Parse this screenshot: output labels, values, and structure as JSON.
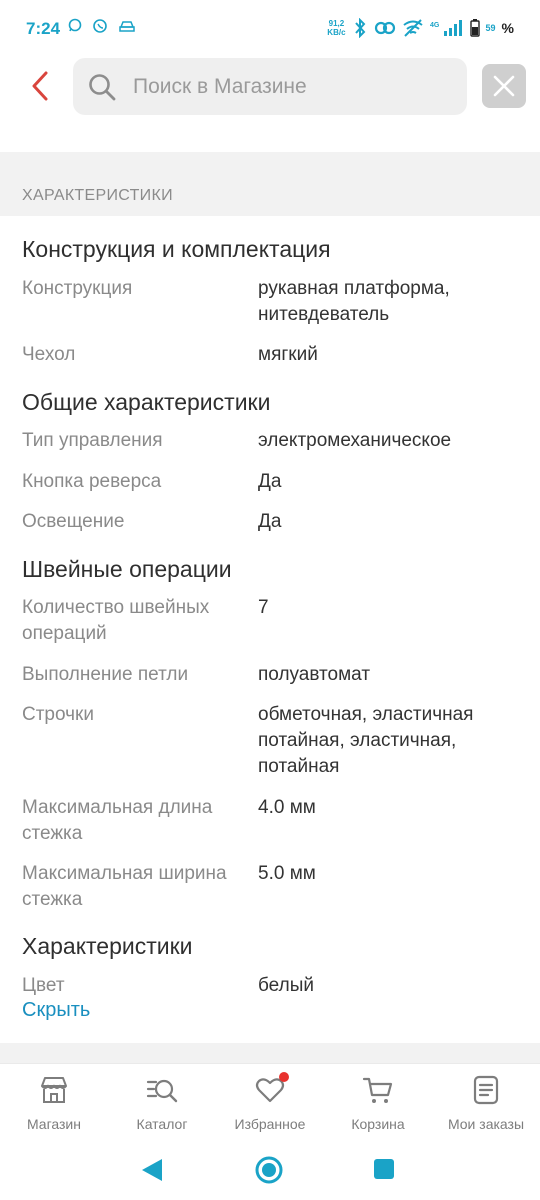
{
  "status_bar": {
    "time": "7:24",
    "net_speed_value": "91,2",
    "net_speed_unit": "KB/c",
    "battery": "59",
    "percent": "%"
  },
  "search": {
    "placeholder": "Поиск в Магазине"
  },
  "section": {
    "title": "ХАРАКТЕРИСТИКИ"
  },
  "groups": [
    {
      "title": "Конструкция и комплектация",
      "rows": [
        {
          "label": "Конструкция",
          "value": "рукавная платформа, нитевдеватель"
        },
        {
          "label": "Чехол",
          "value": "мягкий"
        }
      ]
    },
    {
      "title": "Общие характеристики",
      "rows": [
        {
          "label": "Тип управления",
          "value": "электромеханическое"
        },
        {
          "label": "Кнопка реверса",
          "value": "Да"
        },
        {
          "label": "Освещение",
          "value": "Да"
        }
      ]
    },
    {
      "title": "Швейные операции",
      "rows": [
        {
          "label": "Количество швейных операций",
          "value": "7"
        },
        {
          "label": "Выполнение петли",
          "value": "полуавтомат"
        },
        {
          "label": "Строчки",
          "value": "обметочная, эластичная потайная, эластичная, потайная"
        },
        {
          "label": "Максимальная длина стежка",
          "value": "4.0 мм"
        },
        {
          "label": "Максимальная ширина стежка",
          "value": "5.0 мм"
        }
      ]
    },
    {
      "title": "Характеристики",
      "rows": [
        {
          "label": "Цвет",
          "value": "белый"
        }
      ]
    }
  ],
  "hide_link": "Скрыть",
  "bottom_nav": [
    {
      "label": "Магазин",
      "icon": "store-icon"
    },
    {
      "label": "Каталог",
      "icon": "catalog-search-icon"
    },
    {
      "label": "Избранное",
      "icon": "heart-icon",
      "badge": true
    },
    {
      "label": "Корзина",
      "icon": "cart-icon"
    },
    {
      "label": "Мои заказы",
      "icon": "orders-icon"
    }
  ],
  "colors": {
    "accent": "#1a8fbf",
    "back_arrow": "#d9453d",
    "status_accent": "#1aa3c7",
    "badge": "#e8322e"
  }
}
